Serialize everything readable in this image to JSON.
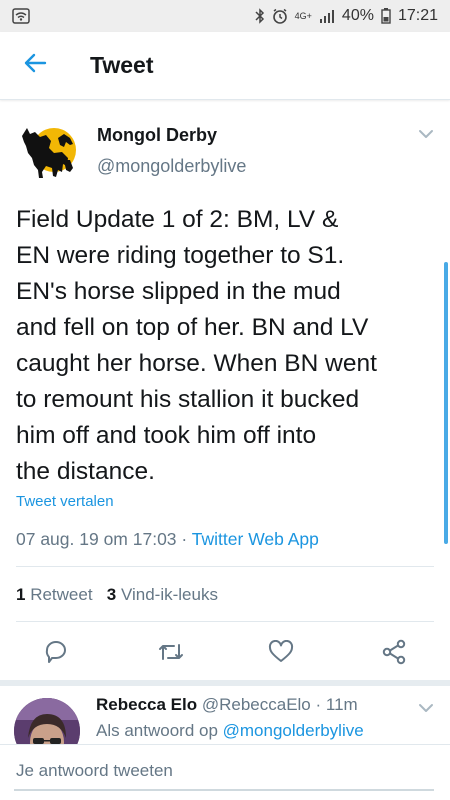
{
  "status_bar": {
    "network": "4G+",
    "battery": "40%",
    "time": "17:21",
    "icons": [
      "wifi-box-icon",
      "bluetooth-icon",
      "alarm-icon",
      "signal-icon",
      "battery-icon"
    ]
  },
  "header": {
    "title": "Tweet",
    "back_icon": "arrow-left-icon"
  },
  "tweet": {
    "author_name": "Mongol Derby",
    "author_handle": "@mongolderbylive",
    "text_lines": [
      "Field Update 1 of 2: BM, LV &",
      "EN were riding together to S1.",
      "EN's horse slipped in the mud",
      "and fell on top of her. BN and LV",
      "caught her horse. When BN went",
      "to remount his stallion it bucked",
      "him off and took him off into",
      "the distance."
    ],
    "translate_label": "Tweet vertalen",
    "timestamp": "07 aug. 19 om 17:03",
    "separator": " · ",
    "source": "Twitter Web App",
    "retweet_count": "1",
    "retweet_label": "Retweet",
    "like_count": "3",
    "like_label": "Vind-ik-leuks"
  },
  "actions": [
    "reply-icon",
    "retweet-icon",
    "like-icon",
    "share-icon"
  ],
  "reply": {
    "name": "Rebecca Elo",
    "handle": "@RebeccaElo",
    "time": "· 11m",
    "prefix": "Als antwoord op",
    "mention": "@mongolderbylive"
  },
  "compose": {
    "placeholder": "Je antwoord tweeten"
  },
  "colors": {
    "accent": "#1b95e0",
    "secondary_text": "#657786",
    "logo_yellow": "#f2b705"
  }
}
